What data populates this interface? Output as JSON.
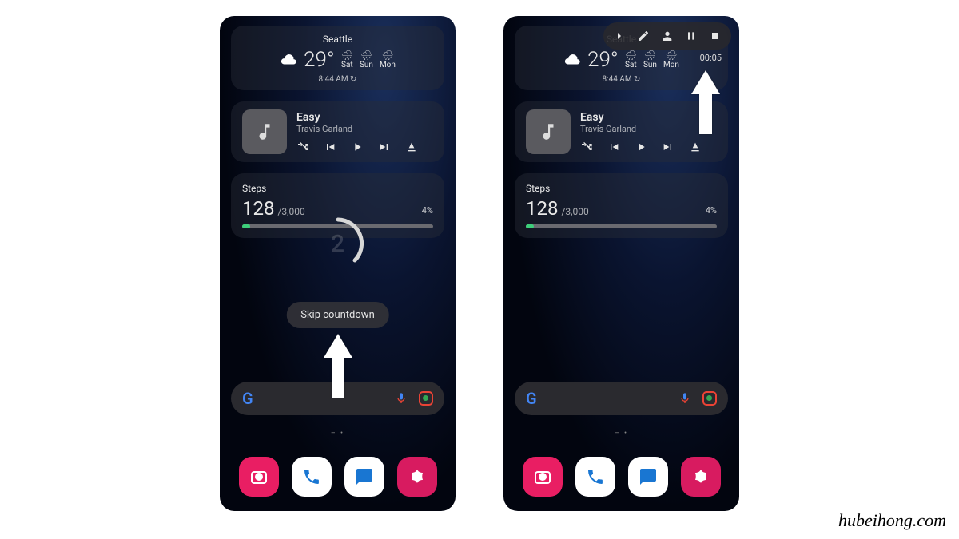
{
  "weather": {
    "city": "Seattle",
    "temp": "29°",
    "days": [
      "Sat",
      "Sun",
      "Mon"
    ],
    "time": "8:44 AM"
  },
  "music": {
    "title": "Easy",
    "artist": "Travis Garland"
  },
  "steps": {
    "label": "Steps",
    "count": "128",
    "goal": "/3,000",
    "pct": "4%"
  },
  "countdown": {
    "number": "2",
    "skip_label": "Skip countdown"
  },
  "recording": {
    "time": "00:05"
  },
  "search": {
    "logo_letters": [
      "G"
    ]
  },
  "watermark": "hubeihong.com"
}
